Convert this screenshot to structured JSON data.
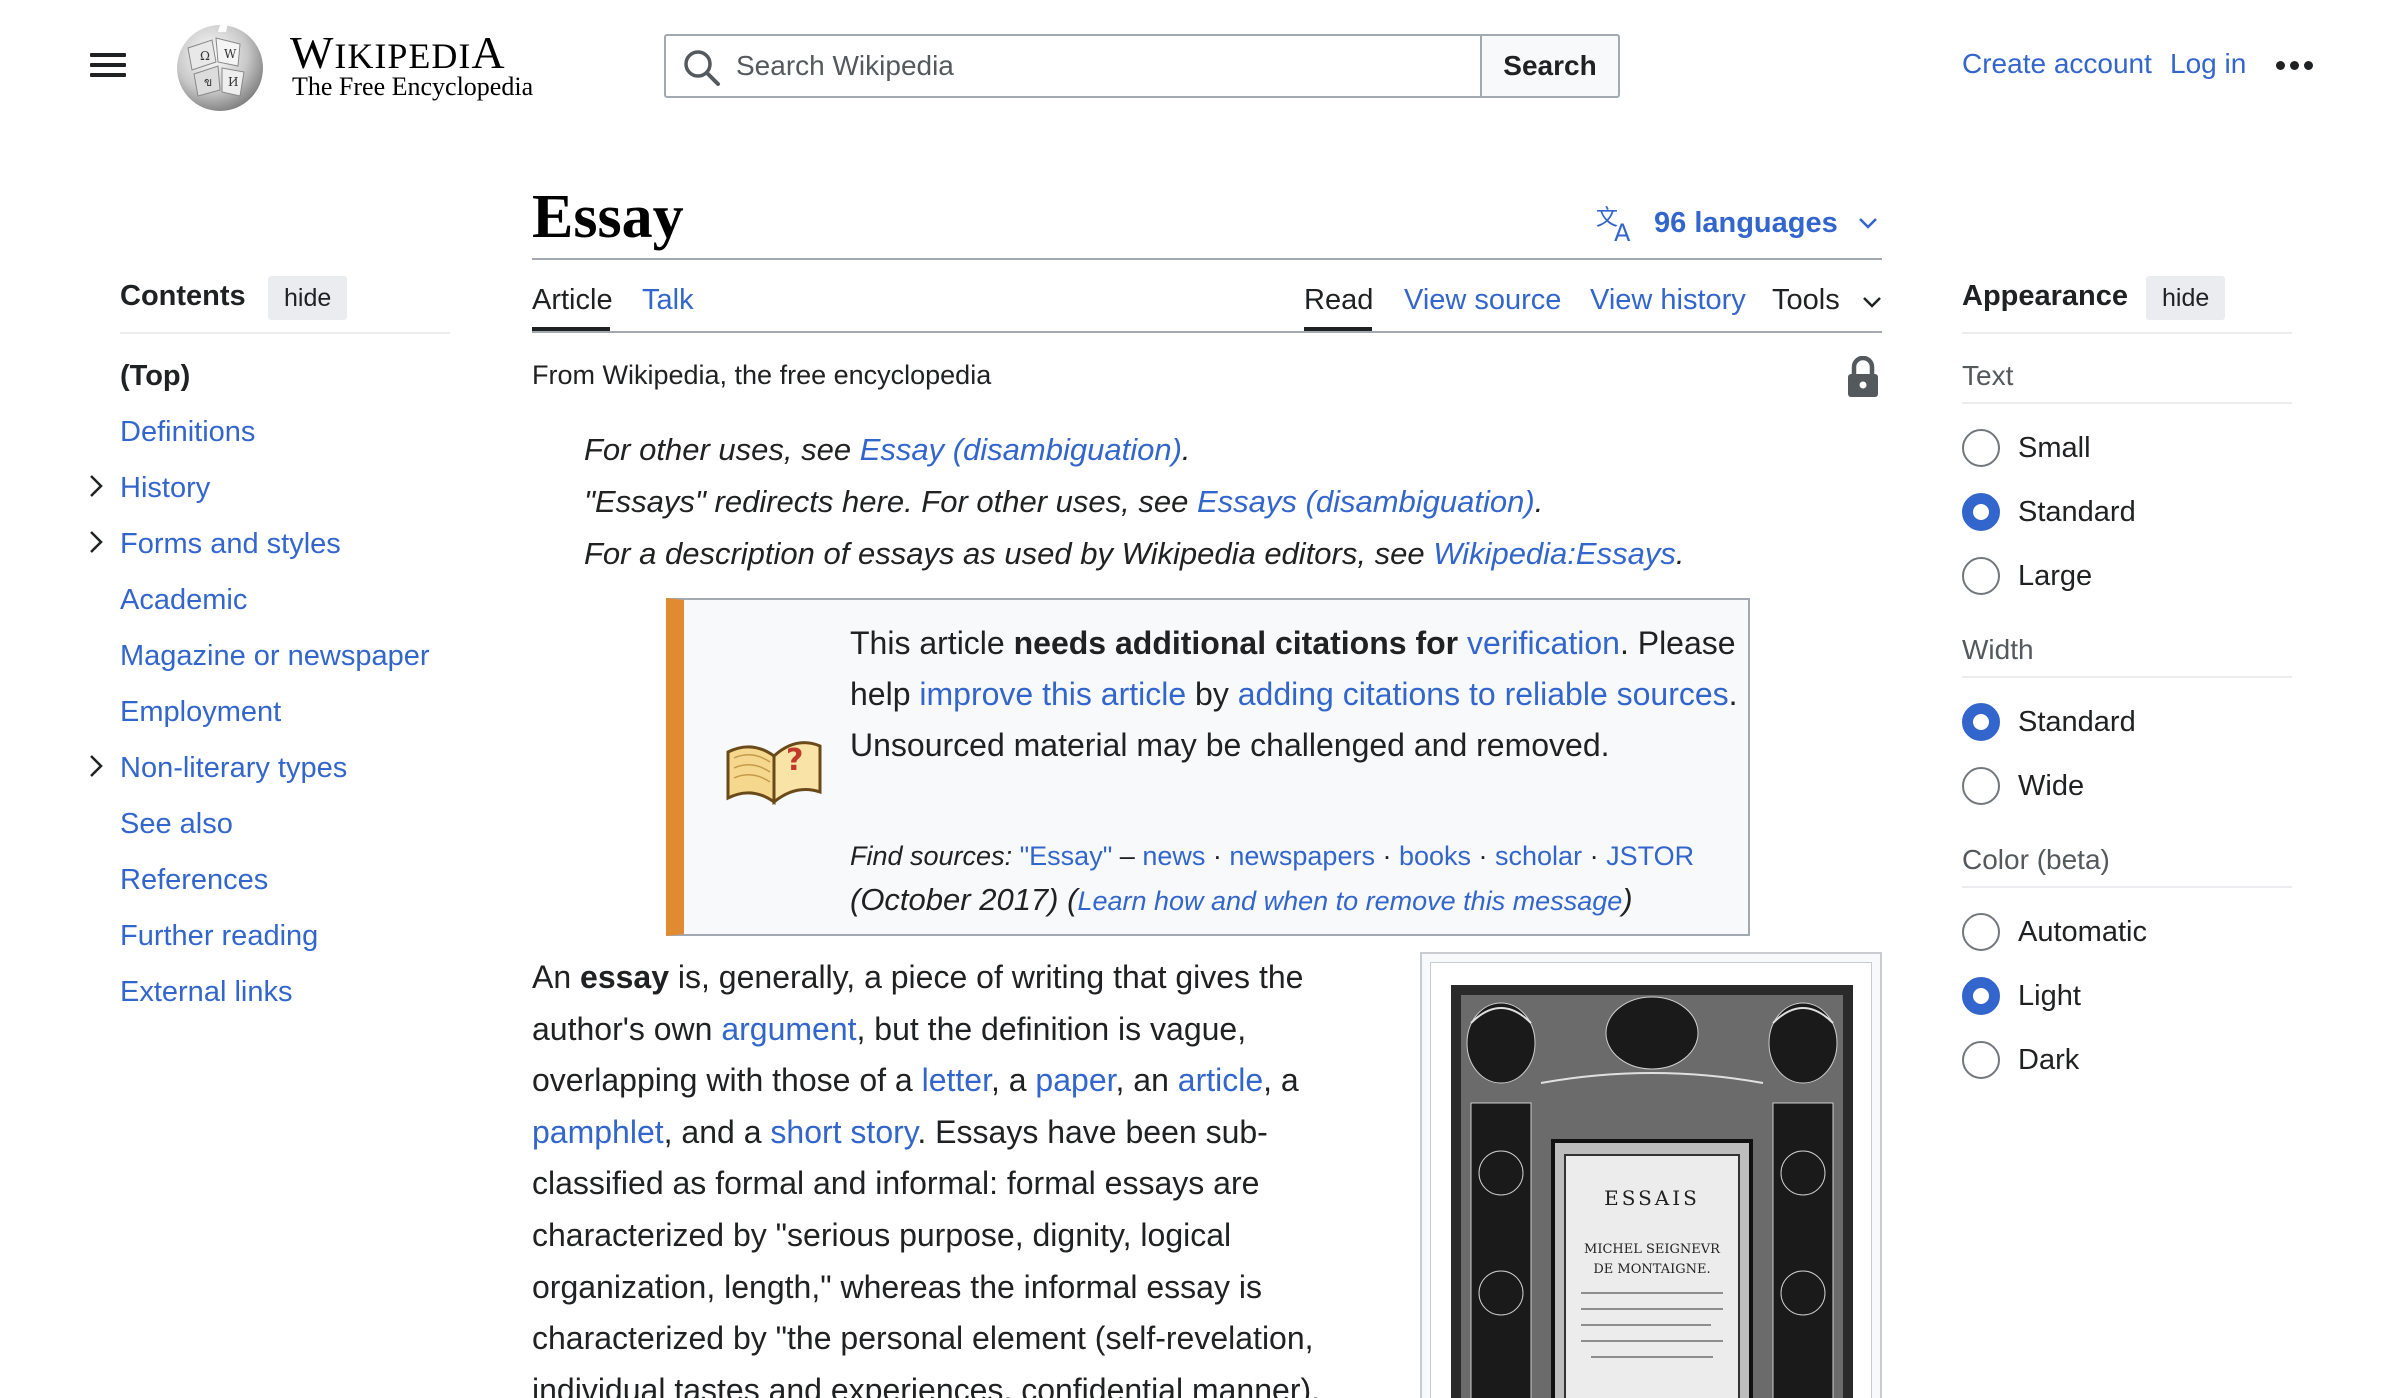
{
  "header": {
    "wordmark_big_w": "W",
    "wordmark_rest": "IKIPEDI",
    "wordmark_big_a": "A",
    "tagline": "The Free Encyclopedia",
    "search_placeholder": "Search Wikipedia",
    "search_button": "Search",
    "create_account": "Create account",
    "log_in": "Log in"
  },
  "toc": {
    "title": "Contents",
    "hide": "hide",
    "items": [
      {
        "label": "(Top)",
        "expandable": false
      },
      {
        "label": "Definitions",
        "expandable": false
      },
      {
        "label": "History",
        "expandable": true
      },
      {
        "label": "Forms and styles",
        "expandable": true
      },
      {
        "label": "Academic",
        "expandable": false
      },
      {
        "label": "Magazine or newspaper",
        "expandable": false
      },
      {
        "label": "Employment",
        "expandable": false
      },
      {
        "label": "Non-literary types",
        "expandable": true
      },
      {
        "label": "See also",
        "expandable": false
      },
      {
        "label": "References",
        "expandable": false
      },
      {
        "label": "Further reading",
        "expandable": false
      },
      {
        "label": "External links",
        "expandable": false
      }
    ]
  },
  "article": {
    "title": "Essay",
    "languages": "96 languages",
    "tabs": {
      "article": "Article",
      "talk": "Talk",
      "read": "Read",
      "view_source": "View source",
      "view_history": "View history",
      "tools": "Tools"
    },
    "from": "From Wikipedia, the free encyclopedia",
    "hatnotes": [
      {
        "pre": "For other uses, see ",
        "link": "Essay (disambiguation)",
        "post": "."
      },
      {
        "pre": "\"Essays\" redirects here. For other uses, see ",
        "link": "Essays (disambiguation)",
        "post": "."
      },
      {
        "pre": "For a description of essays as used by Wikipedia editors, see ",
        "link": "Wikipedia:Essays",
        "post": "."
      }
    ],
    "ambox": {
      "t1": "This article ",
      "t2": "needs additional citations for ",
      "l1": "verification",
      "t3": ". Please help ",
      "l2": "improve this article",
      "t4": " by ",
      "l3": "adding citations to reliable sources",
      "t5": ". Unsourced material may be challenged and removed.",
      "find_label": "Find sources:",
      "find_q": "\"Essay\"",
      "find_dash": " – ",
      "find_news": "news",
      "find_newspapers": "newspapers",
      "find_books": "books",
      "find_scholar": "scholar",
      "find_jstor": "JSTOR",
      "dot": " · ",
      "date": "(October 2017)",
      "paren_open": " (",
      "learn": "Learn how and when to remove this message",
      "paren_close": ")"
    },
    "body": {
      "b1": "An ",
      "bold": "essay",
      "b2": " is, generally, a piece of writing that gives the author's own ",
      "l_argument": "argument",
      "b3": ", but the definition is vague, overlapping with those of a ",
      "l_letter": "letter",
      "b4": ", a ",
      "l_paper": "paper",
      "b5": ", an ",
      "l_article": "article",
      "b6": ", a ",
      "l_pamphlet": "pamphlet",
      "b7": ", and a ",
      "l_short_story": "short story",
      "b8": ". Essays have been sub-classified as formal and informal: formal essays are characterized by \"serious purpose, dignity, logical organization, length,\" whereas the informal essay is characterized by \"the personal element (self-revelation, individual tastes and experiences, confidential manner),"
    },
    "image": {
      "line1": "ESSAIS",
      "line2": "MICHEL SEIGNEVR",
      "line3": "DE MONTAIGNE."
    }
  },
  "appearance": {
    "title": "Appearance",
    "hide": "hide",
    "text_label": "Text",
    "text_options": [
      "Small",
      "Standard",
      "Large"
    ],
    "text_selected": "Standard",
    "width_label": "Width",
    "width_options": [
      "Standard",
      "Wide"
    ],
    "width_selected": "Standard",
    "color_label": "Color (beta)",
    "color_options": [
      "Automatic",
      "Light",
      "Dark"
    ],
    "color_selected": "Light"
  },
  "colors": {
    "link": "#3366cc",
    "text": "#202122",
    "ambox_accent": "#e08a32"
  }
}
